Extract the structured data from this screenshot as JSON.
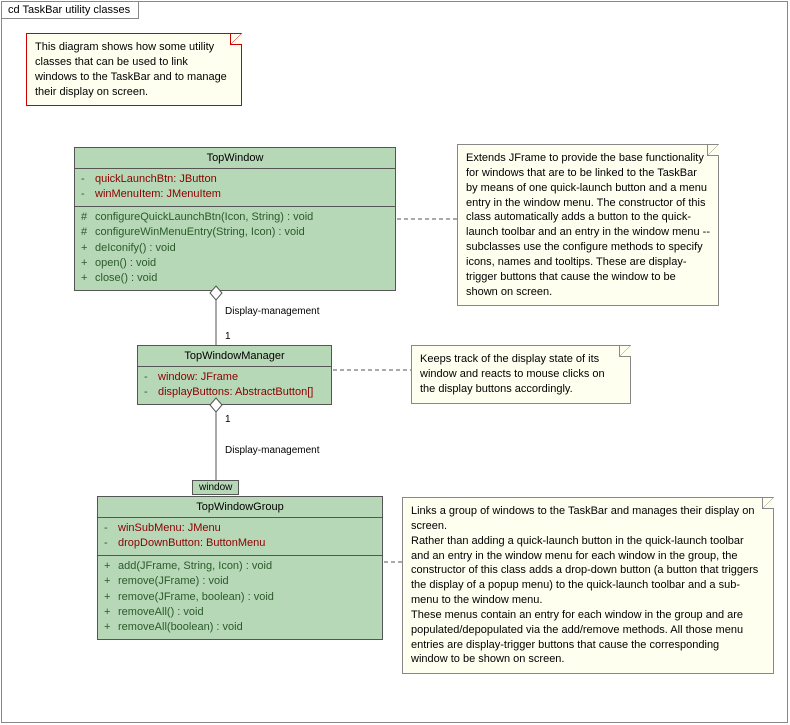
{
  "frame": {
    "title": "cd TaskBar utility classes"
  },
  "notes": {
    "intro": "This diagram shows how some utility classes that can be used to link windows to the TaskBar and to manage their display on screen.",
    "topWindow": "Extends JFrame to provide the base functionality for windows that are to be linked to the TaskBar by means of one quick-launch button and a menu entry in the window menu. The constructor of this class automatically adds a button to the quick-launch toolbar and an entry in the window menu -- subclasses use the configure methods to specify icons, names and tooltips. These are display-trigger buttons that cause the window to be shown on screen.",
    "topWindowManager": "Keeps track of the display state of its window and reacts to mouse clicks on the display buttons accordingly.",
    "topWindowGroup": "Links a group of windows to the TaskBar and manages their display on screen.\nRather than adding a quick-launch button in the quick-launch toolbar and an entry in the window menu for each window in the group, the constructor of this class adds a drop-down button (a button that triggers the display of a popup menu) to the quick-launch toolbar and a sub-menu to the window menu.\nThese menus contain an entry for each window in the group and are populated/depopulated via the add/remove methods. All those menu entries are display-trigger buttons that cause the corresponding\nwindow to be shown on screen."
  },
  "classes": {
    "topWindow": {
      "name": "TopWindow",
      "attrs": [
        {
          "vis": "-",
          "text": "quickLaunchBtn:  JButton"
        },
        {
          "vis": "-",
          "text": "winMenuItem:  JMenuItem"
        }
      ],
      "ops": [
        {
          "vis": "#",
          "text": "configureQuickLaunchBtn(Icon, String) : void"
        },
        {
          "vis": "#",
          "text": "configureWinMenuEntry(String, Icon) : void"
        },
        {
          "vis": "+",
          "text": "deIconify() : void"
        },
        {
          "vis": "+",
          "text": "open() : void"
        },
        {
          "vis": "+",
          "text": "close() : void"
        }
      ]
    },
    "topWindowManager": {
      "name": "TopWindowManager",
      "attrs": [
        {
          "vis": "-",
          "text": "window:  JFrame"
        },
        {
          "vis": "-",
          "text": "displayButtons:  AbstractButton[]"
        }
      ]
    },
    "topWindowGroup": {
      "name": "TopWindowGroup",
      "attrs": [
        {
          "vis": "-",
          "text": "winSubMenu:  JMenu"
        },
        {
          "vis": "-",
          "text": "dropDownButton:  ButtonMenu"
        }
      ],
      "ops": [
        {
          "vis": "+",
          "text": "add(JFrame, String, Icon) : void"
        },
        {
          "vis": "+",
          "text": "remove(JFrame) : void"
        },
        {
          "vis": "+",
          "text": "remove(JFrame, boolean) : void"
        },
        {
          "vis": "+",
          "text": "removeAll() : void"
        },
        {
          "vis": "+",
          "text": "removeAll(boolean) : void"
        }
      ]
    }
  },
  "assoc": {
    "label1": "Display-management",
    "mult1": "1",
    "label2": "Display-management",
    "mult2": "1",
    "roleWindow": "window"
  }
}
